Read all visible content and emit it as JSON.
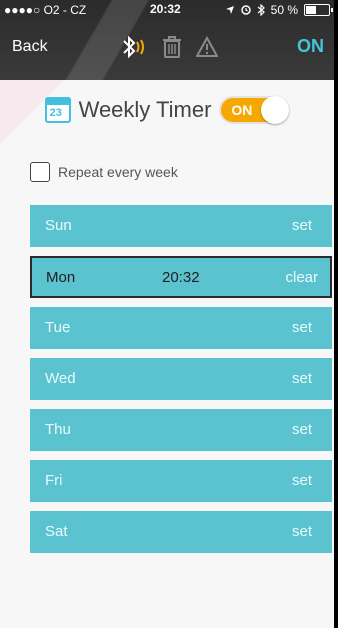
{
  "status": {
    "carrier": "●●●●○ O2 - CZ",
    "time": "20:32",
    "battery": "50 %"
  },
  "nav": {
    "back_label": "Back",
    "on_label": "ON"
  },
  "header": {
    "calendar_day": "23",
    "title": "Weekly Timer",
    "toggle_label": "ON"
  },
  "repeat": {
    "label": "Repeat every week",
    "checked": false
  },
  "days": [
    {
      "name": "Sun",
      "action": "set"
    },
    {
      "name": "Mon",
      "time": "20:32",
      "action": "clear"
    },
    {
      "name": "Tue",
      "action": "set"
    },
    {
      "name": "Wed",
      "action": "set"
    },
    {
      "name": "Thu",
      "action": "set"
    },
    {
      "name": "Fri",
      "action": "set"
    },
    {
      "name": "Sat",
      "action": "set"
    }
  ],
  "colors": {
    "accent": "#43c6dc",
    "day_row": "#5bc3cf",
    "toggle_on": "#f7a800"
  }
}
